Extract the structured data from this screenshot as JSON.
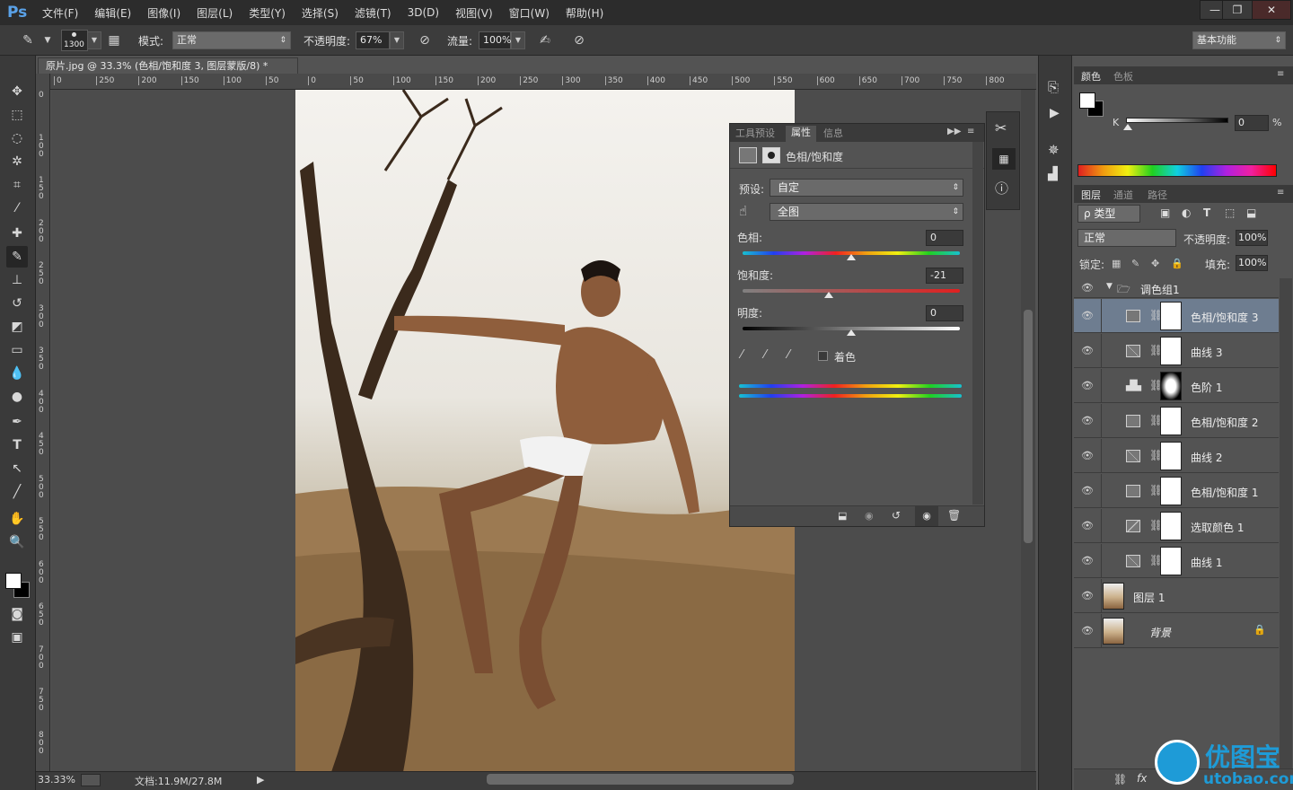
{
  "app": {
    "logo": "Ps",
    "menu": [
      "文件(F)",
      "编辑(E)",
      "图像(I)",
      "图层(L)",
      "类型(Y)",
      "选择(S)",
      "滤镜(T)",
      "3D(D)",
      "视图(V)",
      "窗口(W)",
      "帮助(H)"
    ],
    "window_buttons": [
      "—",
      "❐",
      "✕"
    ]
  },
  "options": {
    "brush_size": "1300",
    "mode_label": "模式:",
    "mode_value": "正常",
    "opacity_label": "不透明度:",
    "opacity_value": "67%",
    "flow_label": "流量:",
    "flow_value": "100%",
    "workspace": "基本功能"
  },
  "document": {
    "tab_title": "原片.jpg @ 33.3% (色相/饱和度 3, 图层蒙版/8) *",
    "zoom": "33.33%",
    "doc_info": "文档:11.9M/27.8M",
    "ruler_top": [
      "0",
      "250",
      "200",
      "150",
      "100",
      "50",
      "0",
      "50",
      "100",
      "150",
      "200",
      "250",
      "300",
      "350",
      "400",
      "450",
      "500",
      "550",
      "600",
      "650",
      "700",
      "750",
      "800"
    ],
    "ruler_left": [
      "0",
      "1 0 0",
      "1 5 0",
      "2 0 0",
      "2 5 0",
      "3 0 0",
      "3 5 0",
      "4 0 0",
      "4 5 0",
      "5 0 0",
      "5 5 0",
      "6 0 0",
      "6 5 0",
      "7 0 0",
      "7 5 0",
      "8 0 0"
    ]
  },
  "properties": {
    "tabs": [
      "工具预设",
      "属性",
      "信息"
    ],
    "title": "色相/饱和度",
    "preset_label": "预设:",
    "preset_value": "自定",
    "range_value": "全图",
    "hue_label": "色相:",
    "hue_value": "0",
    "hue_position": 0.5,
    "saturation_label": "饱和度:",
    "saturation_value": "-21",
    "saturation_position": 0.395,
    "lightness_label": "明度:",
    "lightness_value": "0",
    "lightness_position": 0.5,
    "colorize_label": "着色"
  },
  "color_panel": {
    "tabs": [
      "颜色",
      "色板"
    ],
    "channel": "K",
    "value": "0",
    "unit": "%"
  },
  "layers_panel": {
    "tabs": [
      "图层",
      "通道",
      "路径"
    ],
    "filter": "ρ 类型",
    "blend_mode": "正常",
    "opacity_label": "不透明度:",
    "opacity_value": "100%",
    "lock_label": "锁定:",
    "fill_label": "填充:",
    "fill_value": "100%",
    "group": "调色组1",
    "layers": [
      {
        "name": "色相/饱和度 3",
        "type": "hue"
      },
      {
        "name": "曲线 3",
        "type": "curves"
      },
      {
        "name": "色阶 1",
        "type": "levels"
      },
      {
        "name": "色相/饱和度 2",
        "type": "hue"
      },
      {
        "name": "曲线 2",
        "type": "curves"
      },
      {
        "name": "色相/饱和度 1",
        "type": "hue"
      },
      {
        "name": "选取颜色 1",
        "type": "selective"
      },
      {
        "name": "曲线 1",
        "type": "curves"
      },
      {
        "name": "图层 1",
        "type": "image"
      },
      {
        "name": "背景",
        "type": "image"
      }
    ]
  },
  "watermark": {
    "text": "优图宝",
    "url": "utobao.com"
  },
  "colors": {
    "selection": "#6e7d90",
    "panel": "#535353",
    "chrome": "#3a3a3a"
  }
}
